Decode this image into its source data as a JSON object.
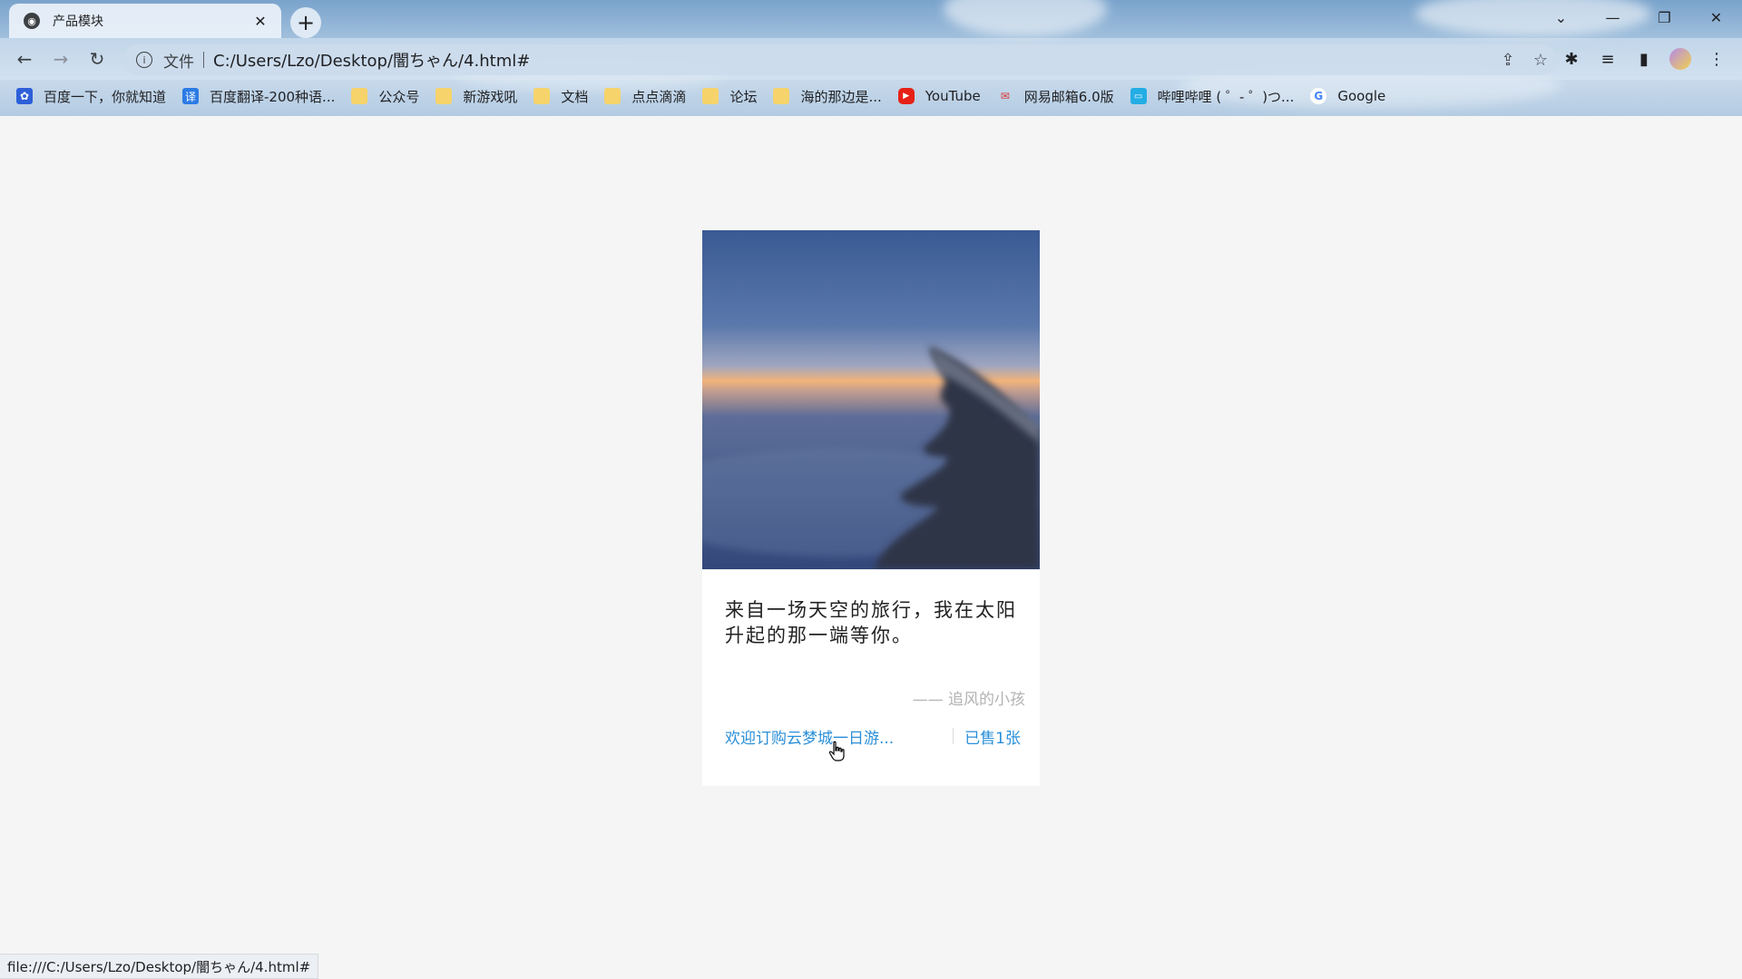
{
  "browser": {
    "tab_title": "产品模块",
    "tab_close": "✕",
    "new_tab": "+",
    "address_scheme": "文件",
    "address_url": "C:/Users/Lzo/Desktop/闇ちゃん/4.html#",
    "window_buttons": [
      "⌄",
      "—",
      "❐",
      "✕"
    ],
    "bookmarks": [
      {
        "label": "百度一下，你就知道",
        "icon": "baidu-icon"
      },
      {
        "label": "百度翻译-200种语...",
        "icon": "translate-icon"
      },
      {
        "label": "公众号",
        "icon": "folder-icon"
      },
      {
        "label": "新游戏吼",
        "icon": "folder-icon"
      },
      {
        "label": "文档",
        "icon": "folder-icon"
      },
      {
        "label": "点点滴滴",
        "icon": "folder-icon"
      },
      {
        "label": "论坛",
        "icon": "folder-icon"
      },
      {
        "label": "海的那边是...",
        "icon": "folder-icon"
      },
      {
        "label": "YouTube",
        "icon": "youtube-icon"
      },
      {
        "label": "网易邮箱6.0版",
        "icon": "netease-mail-icon"
      },
      {
        "label": "哔哩哔哩 ( ゜- ゜)つ...",
        "icon": "bilibili-icon"
      },
      {
        "label": "Google",
        "icon": "google-icon"
      }
    ],
    "status_url": "file:///C:/Users/Lzo/Desktop/闇ちゃん/4.html#"
  },
  "card": {
    "quote": "来自一场天空的旅行，我在太阳升起的那一端等你。",
    "author": "—— 追风的小孩",
    "buy_link": "欢迎订购云梦城一日游...",
    "sold": "已售1张"
  }
}
